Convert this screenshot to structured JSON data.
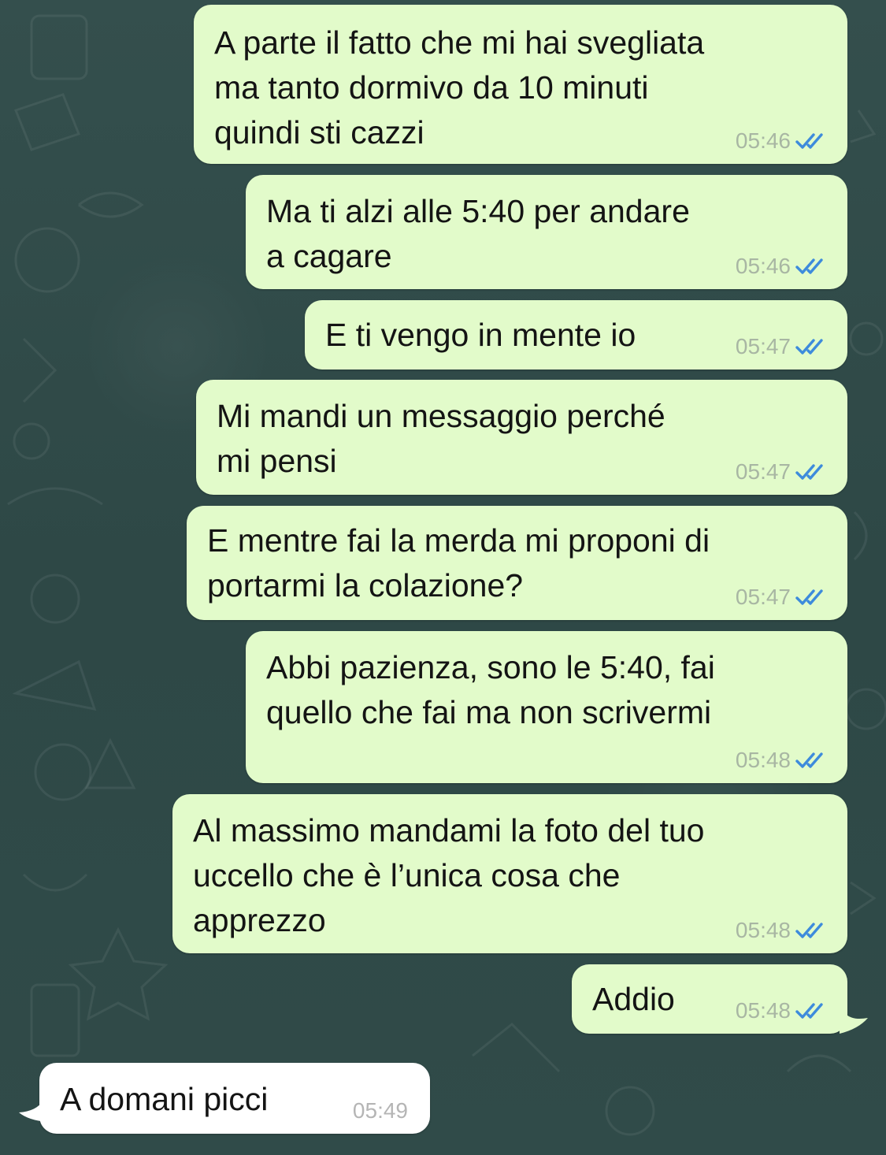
{
  "colors": {
    "background": "#2f4a48",
    "outgoing_bubble": "#e2fbca",
    "incoming_bubble": "#ffffff",
    "read_ticks": "#3d8bdc",
    "timestamp": "#a8b6a3"
  },
  "messages": [
    {
      "direction": "outgoing",
      "text": "A parte il fatto che mi hai svegliata\nma tanto dormivo da 10 minuti\nquindi sti cazzi",
      "time": "05:46",
      "status": "read-double-check-icon"
    },
    {
      "direction": "outgoing",
      "text": "Ma ti alzi alle 5:40 per andare\na cagare",
      "time": "05:46",
      "status": "read-double-check-icon"
    },
    {
      "direction": "outgoing",
      "text": "E ti vengo in mente io",
      "time": "05:47",
      "status": "read-double-check-icon"
    },
    {
      "direction": "outgoing",
      "text": "Mi mandi un messaggio perché\nmi pensi",
      "time": "05:47",
      "status": "read-double-check-icon"
    },
    {
      "direction": "outgoing",
      "text": "E mentre fai la merda mi proponi di\nportarmi la colazione?",
      "time": "05:47",
      "status": "read-double-check-icon"
    },
    {
      "direction": "outgoing",
      "text": "Abbi pazienza, sono le 5:40, fai\nquello che fai ma non scrivermi",
      "time": "05:48",
      "status": "read-double-check-icon"
    },
    {
      "direction": "outgoing",
      "text": "Al massimo mandami la foto del tuo\nuccello che è l’unica cosa che\napprezzo",
      "time": "05:48",
      "status": "read-double-check-icon"
    },
    {
      "direction": "outgoing",
      "text": "Addio",
      "time": "05:48",
      "status": "read-double-check-icon"
    },
    {
      "direction": "incoming",
      "text": "A domani picci",
      "time": "05:49"
    }
  ]
}
